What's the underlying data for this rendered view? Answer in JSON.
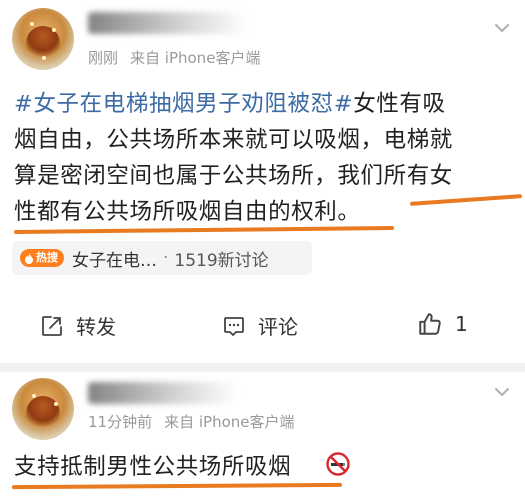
{
  "post1": {
    "time": "刚刚",
    "source": "来自 iPhone客户端",
    "hashtag": "#女子在电梯抽烟男子劝阻被怼#",
    "text_line1_rest": "女性有吸",
    "text_line2": "烟自由，公共场所本来就可以吸烟，电梯就",
    "text_line3": "算是密闭空间也属于公共场所，我们所有女",
    "text_line4": "性都有公共场所吸烟自由的权利。",
    "topic_chip": {
      "badge": "热搜",
      "title": "女子在电…",
      "separator": "·",
      "count": "1519新讨论"
    },
    "actions": {
      "repost_label": "转发",
      "comment_label": "评论",
      "like_count": "1"
    }
  },
  "post2": {
    "time": "11分钟前",
    "source": "来自 iPhone客户端",
    "text": "支持抵制男性公共场所吸烟"
  },
  "colors": {
    "hashtag": "#3d6ba5",
    "underline": "#e87a1f",
    "hot_badge": "#ff7f1e",
    "meta_text": "#9a9a9a"
  }
}
